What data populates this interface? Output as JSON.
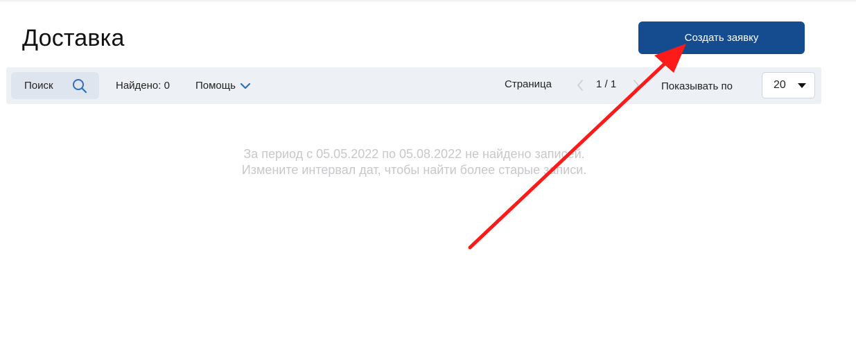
{
  "page": {
    "title": "Доставка",
    "create_button_label": "Создать заявку"
  },
  "toolbar": {
    "search_label": "Поиск",
    "search_icon": "search-icon",
    "found_label": "Найдено: 0",
    "help_label": "Помощь",
    "page_label": "Страница",
    "page_value": "1 / 1",
    "per_page_label": "Показывать по",
    "per_page_value": "20"
  },
  "empty_state": {
    "line1": "За период с 05.05.2022 по 05.08.2022 не найдено записей.",
    "line2": "Измените интервал дат, чтобы найти более старые записи."
  },
  "colors": {
    "primary": "#154c8f",
    "toolbar_bg": "#edf0f4",
    "search_bg": "#dfe5ee",
    "accent_icon": "#2f6fb7",
    "empty_text": "#c6c8cc",
    "annotation_arrow": "#ff1a1a"
  }
}
